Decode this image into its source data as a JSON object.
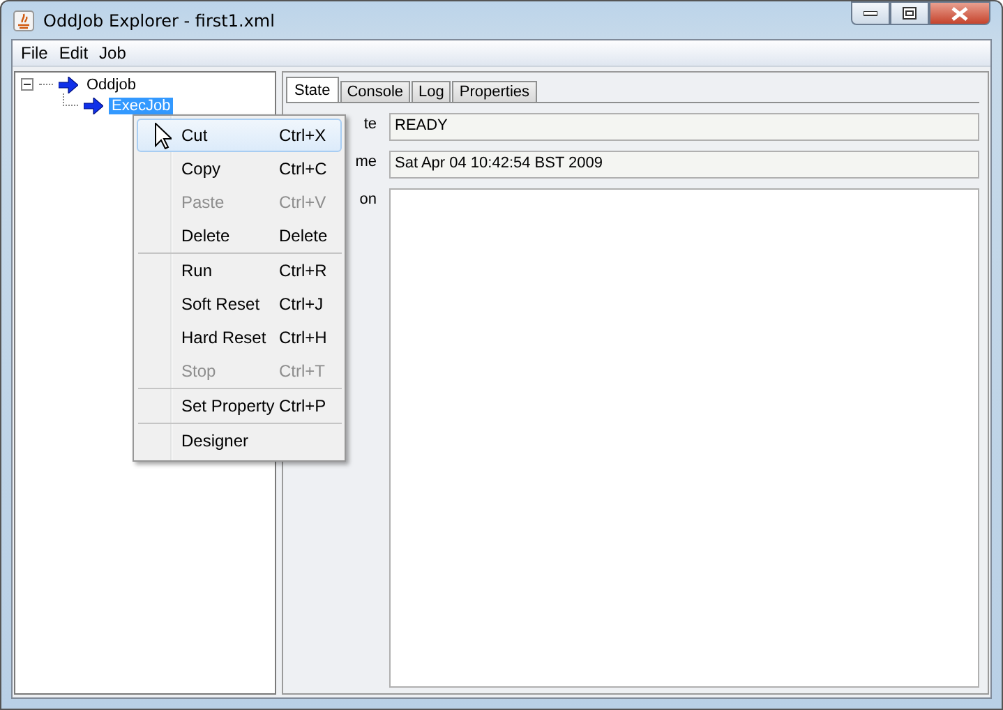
{
  "window": {
    "title": "OddJob Explorer - first1.xml"
  },
  "menubar": [
    "File",
    "Edit",
    "Job"
  ],
  "tree": [
    {
      "label": "Oddjob",
      "expanded": true,
      "selected": false,
      "children": [
        {
          "label": "ExecJob",
          "selected": true
        }
      ]
    }
  ],
  "tabs": [
    {
      "label": "State",
      "selected": true
    },
    {
      "label": "Console",
      "selected": false
    },
    {
      "label": "Log",
      "selected": false
    },
    {
      "label": "Properties",
      "selected": false
    }
  ],
  "fields": [
    {
      "label": "te",
      "value": "READY",
      "kind": "line"
    },
    {
      "label": "me",
      "value": "Sat Apr 04 10:42:54 BST 2009",
      "kind": "line"
    },
    {
      "label": "on",
      "kind": "area"
    }
  ],
  "context_menu": [
    {
      "label": "Cut",
      "shortcut": "Ctrl+X",
      "disabled": false,
      "selected": true,
      "separator_after": false
    },
    {
      "label": "Copy",
      "shortcut": "Ctrl+C",
      "disabled": false,
      "selected": false,
      "separator_after": false
    },
    {
      "label": "Paste",
      "shortcut": "Ctrl+V",
      "disabled": true,
      "selected": false,
      "separator_after": false
    },
    {
      "label": "Delete",
      "shortcut": "Delete",
      "disabled": false,
      "selected": false,
      "separator_after": true
    },
    {
      "label": "Run",
      "shortcut": "Ctrl+R",
      "disabled": false,
      "selected": false,
      "separator_after": false
    },
    {
      "label": "Soft Reset",
      "shortcut": "Ctrl+J",
      "disabled": false,
      "selected": false,
      "separator_after": false
    },
    {
      "label": "Hard Reset",
      "shortcut": "Ctrl+H",
      "disabled": false,
      "selected": false,
      "separator_after": false
    },
    {
      "label": "Stop",
      "shortcut": "Ctrl+T",
      "disabled": true,
      "selected": false,
      "separator_after": true
    },
    {
      "label": "Set Property",
      "shortcut": "Ctrl+P",
      "disabled": false,
      "selected": false,
      "separator_after": true
    },
    {
      "label": "Designer",
      "disabled": false,
      "selected": false,
      "separator_after": false
    }
  ]
}
